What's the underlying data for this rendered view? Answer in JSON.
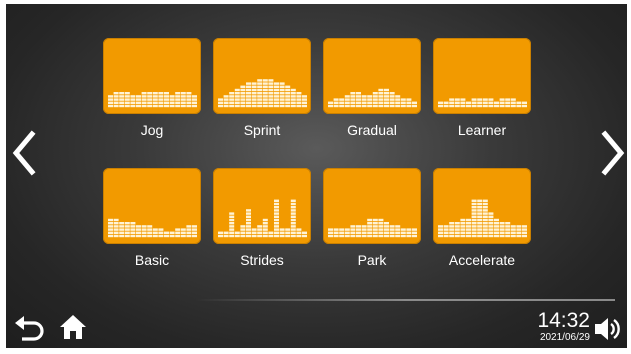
{
  "programs": [
    {
      "label": "Jog",
      "icon": "jog-profile-icon",
      "levels": [
        4,
        5,
        5,
        5,
        4,
        4,
        5,
        5,
        5,
        5,
        5,
        4,
        5,
        5,
        5,
        4
      ]
    },
    {
      "label": "Sprint",
      "icon": "sprint-profile-icon",
      "levels": [
        3,
        4,
        5,
        6,
        7,
        8,
        8,
        9,
        9,
        9,
        8,
        8,
        7,
        6,
        5,
        4
      ]
    },
    {
      "label": "Gradual",
      "icon": "gradual-profile-icon",
      "levels": [
        2,
        3,
        3,
        4,
        5,
        5,
        4,
        4,
        5,
        6,
        6,
        5,
        4,
        3,
        3,
        2
      ]
    },
    {
      "label": "Learner",
      "icon": "learner-profile-icon",
      "levels": [
        2,
        2,
        3,
        3,
        3,
        2,
        3,
        3,
        3,
        3,
        2,
        3,
        3,
        3,
        2,
        2
      ]
    },
    {
      "label": "Basic",
      "icon": "basic-profile-icon",
      "levels": [
        6,
        6,
        5,
        5,
        5,
        4,
        4,
        4,
        3,
        3,
        2,
        2,
        3,
        3,
        4,
        4
      ]
    },
    {
      "label": "Strides",
      "icon": "strides-profile-icon",
      "levels": [
        2,
        2,
        8,
        2,
        4,
        9,
        3,
        4,
        6,
        2,
        12,
        3,
        3,
        12,
        3,
        2
      ]
    },
    {
      "label": "Park",
      "icon": "park-profile-icon",
      "levels": [
        3,
        3,
        3,
        3,
        4,
        4,
        4,
        6,
        6,
        6,
        5,
        4,
        4,
        3,
        3,
        3
      ]
    },
    {
      "label": "Accelerate",
      "icon": "accelerate-profile-icon",
      "levels": [
        4,
        4,
        5,
        5,
        6,
        6,
        12,
        12,
        12,
        8,
        6,
        5,
        5,
        4,
        4,
        4
      ]
    }
  ],
  "nav": {
    "prev_icon": "chevron-left-icon",
    "next_icon": "chevron-right-icon"
  },
  "footer": {
    "back_icon": "back-arrow-icon",
    "home_icon": "home-icon",
    "time": "14:32",
    "date": "2021/06/29",
    "volume_icon": "speaker-icon"
  },
  "colors": {
    "tile": "#f29a00",
    "bars": "#fff3d6",
    "background": "#2b2b2b",
    "text": "#ffffff"
  }
}
